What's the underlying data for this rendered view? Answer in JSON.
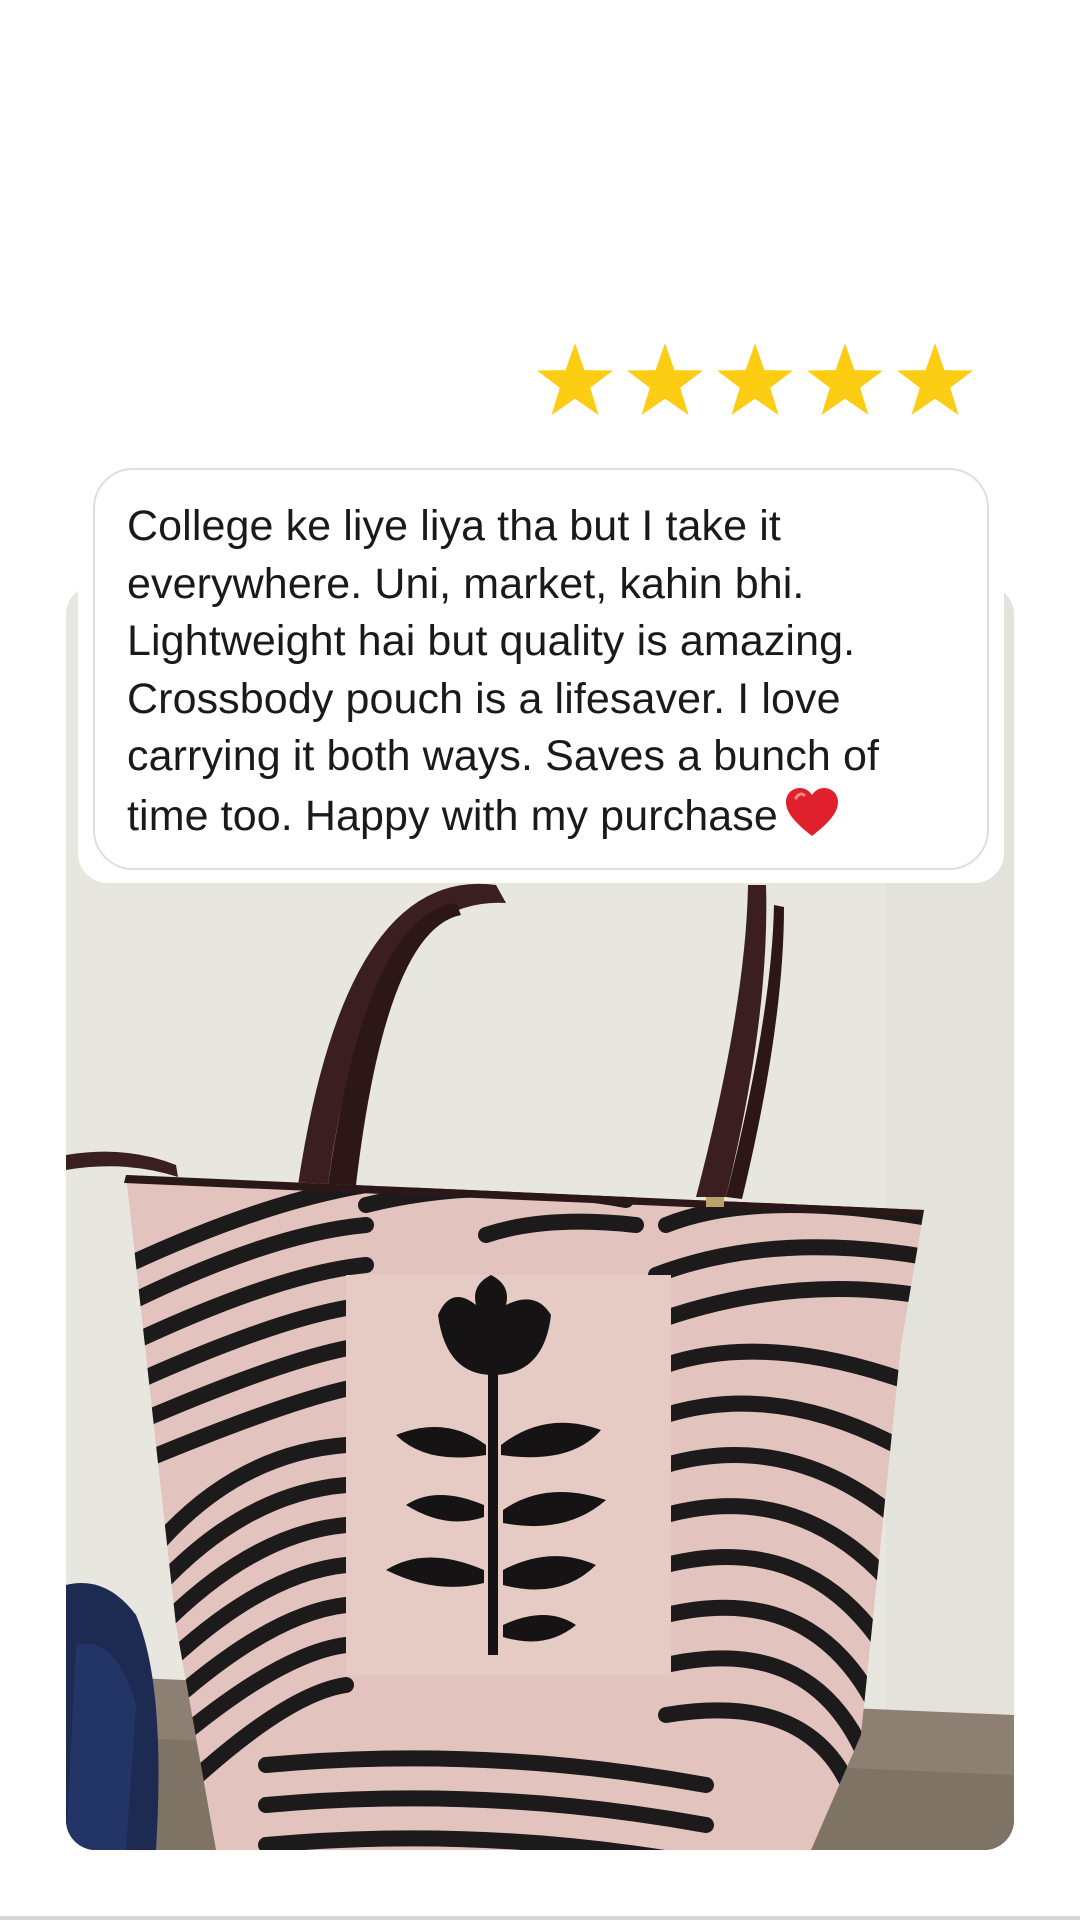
{
  "rating": {
    "value": 5,
    "max": 5,
    "star_color": "#fccd12"
  },
  "review": {
    "text": "College ke liye liya tha but I take it everywhere. Uni, market, kahin bhi. Lightweight hai but quality is amazing. Crossbody pouch is a lifesaver. I love carrying it both ways. Saves a bunch of time too. Happy with my purchase",
    "emoji": "heart-icon"
  },
  "photo": {
    "subject": "tote-bag-photo",
    "colors": {
      "wall": "#e8e7e0",
      "bag_base": "#e2c2bd",
      "stripe": "#1c1a1a",
      "strap": "#3a1f1f",
      "chair": "#8c7f70"
    }
  }
}
